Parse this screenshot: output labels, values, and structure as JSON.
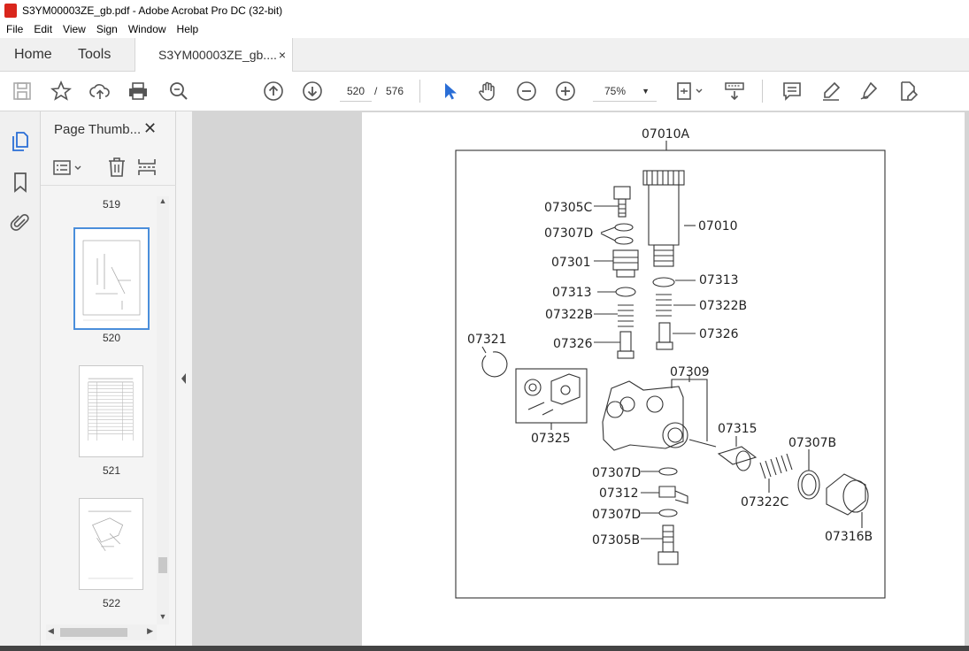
{
  "window": {
    "title": "S3YM00003ZE_gb.pdf - Adobe Acrobat Pro DC (32-bit)"
  },
  "menu": [
    "File",
    "Edit",
    "View",
    "Sign",
    "Window",
    "Help"
  ],
  "tabs": {
    "home": "Home",
    "tools": "Tools",
    "document": "S3YM00003ZE_gb....",
    "close": "×"
  },
  "toolbar": {
    "page_current": "520",
    "page_sep": "/",
    "page_total": "576",
    "zoom": "75%",
    "zoom_caret": "▼"
  },
  "thumbnails": {
    "title": "Page Thumb...",
    "close": "✕",
    "pages": [
      {
        "label": "519"
      },
      {
        "label": "520"
      },
      {
        "label": "521"
      },
      {
        "label": "522"
      }
    ]
  },
  "drawing": {
    "assembly": "07010A",
    "parts": [
      "07305C",
      "07307D",
      "07301",
      "07313",
      "07322B",
      "07326",
      "07010",
      "07313",
      "07322B",
      "07326",
      "07321",
      "07309",
      "07325",
      "07315",
      "07307B",
      "07307D",
      "07312",
      "07307D",
      "07305B",
      "07322C",
      "07316B"
    ]
  }
}
